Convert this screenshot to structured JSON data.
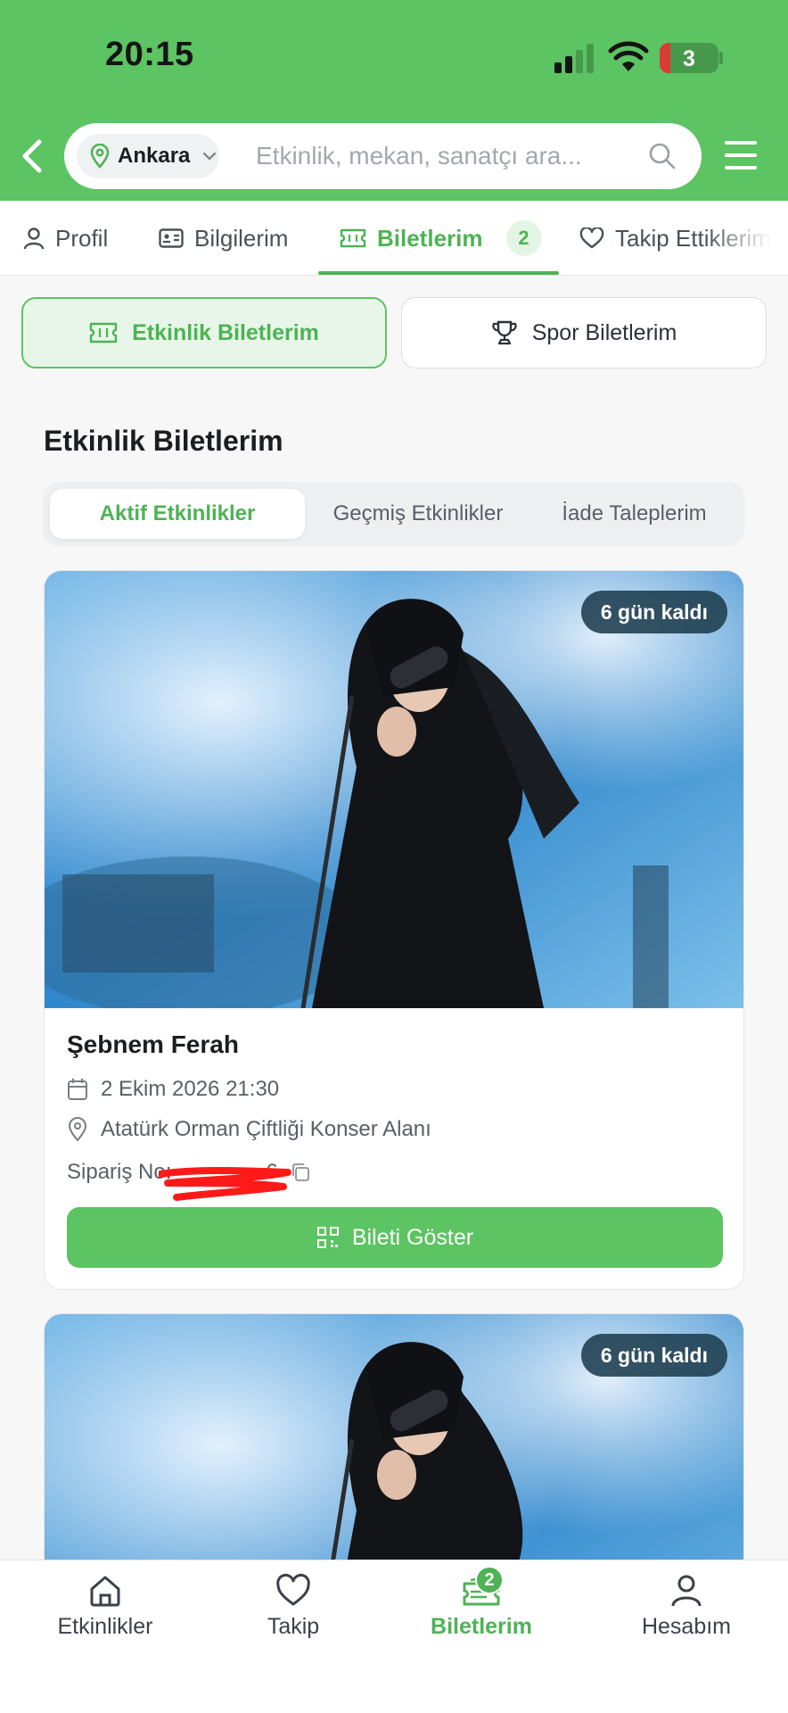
{
  "status_bar": {
    "time": "20:15",
    "battery": "3",
    "battery_fraction": 0.18
  },
  "header": {
    "city": "Ankara",
    "search_placeholder": "Etkinlik, mekan, sanatçı ara..."
  },
  "profile_tabs": [
    {
      "label": "Profil",
      "icon": "user-icon"
    },
    {
      "label": "Bilgilerim",
      "icon": "id-card-icon"
    },
    {
      "label": "Biletlerim",
      "icon": "ticket-icon",
      "badge": "2",
      "active": true
    },
    {
      "label": "Takip Ettiklerim",
      "icon": "heart-icon"
    }
  ],
  "segments": [
    {
      "label": "Etkinlik Biletlerim",
      "icon": "ticket-icon",
      "active": true
    },
    {
      "label": "Spor Biletlerim",
      "icon": "trophy-icon"
    }
  ],
  "section_title": "Etkinlik Biletlerim",
  "sub_tabs": [
    {
      "label": "Aktif Etkinlikler",
      "active": true
    },
    {
      "label": "Geçmiş Etkinlikler"
    },
    {
      "label": "İade Taleplerim"
    }
  ],
  "tickets": [
    {
      "days_left": "6 gün kaldı",
      "title": "Şebnem Ferah",
      "date": "2 Ekim 2026 21:30",
      "venue": "Atatürk Orman Çiftliği Konser Alanı",
      "order_label": "Sipariş No:",
      "order_value_visible": "6",
      "button_label": "Bileti Göster"
    },
    {
      "days_left": "6 gün kaldı"
    }
  ],
  "bottom_nav": [
    {
      "label": "Etkinlikler",
      "icon": "home-icon"
    },
    {
      "label": "Takip",
      "icon": "heart-icon"
    },
    {
      "label": "Biletlerim",
      "icon": "ticket-icon",
      "badge": "2",
      "active": true
    },
    {
      "label": "Hesabım",
      "icon": "user-icon"
    }
  ],
  "colors": {
    "brand_green": "#5cc462",
    "active_green": "#4db354",
    "badge_dark": "#1e3e4e"
  }
}
